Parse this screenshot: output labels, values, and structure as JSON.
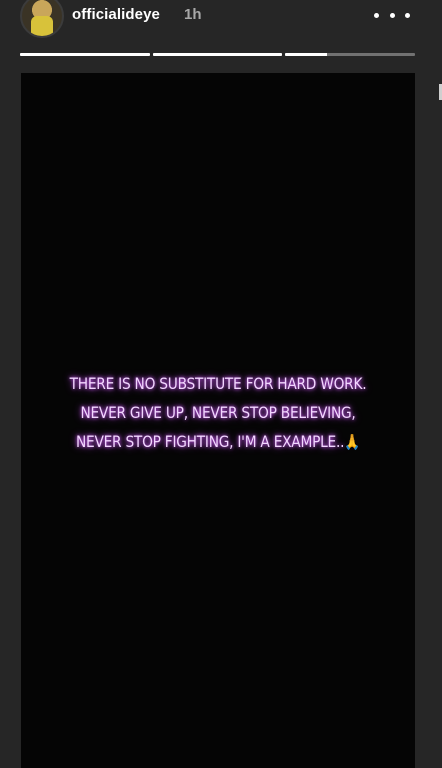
{
  "header": {
    "username": "officialideye",
    "time": "1h",
    "more_label": "•••"
  },
  "progress": {
    "segments": [
      {
        "fill": 1.0
      },
      {
        "fill": 1.0
      },
      {
        "fill": 0.32
      }
    ]
  },
  "story": {
    "lines": [
      "THERE IS NO SUBSTITUTE FOR HARD WORK.",
      "NEVER GIVE UP, NEVER STOP BELIEVING,",
      "NEVER STOP FIGHTING, I'M A EXAMPLE.."
    ],
    "emoji": "🙏",
    "text_color": "#f2d6ff",
    "glow_color": "#c94dff"
  }
}
